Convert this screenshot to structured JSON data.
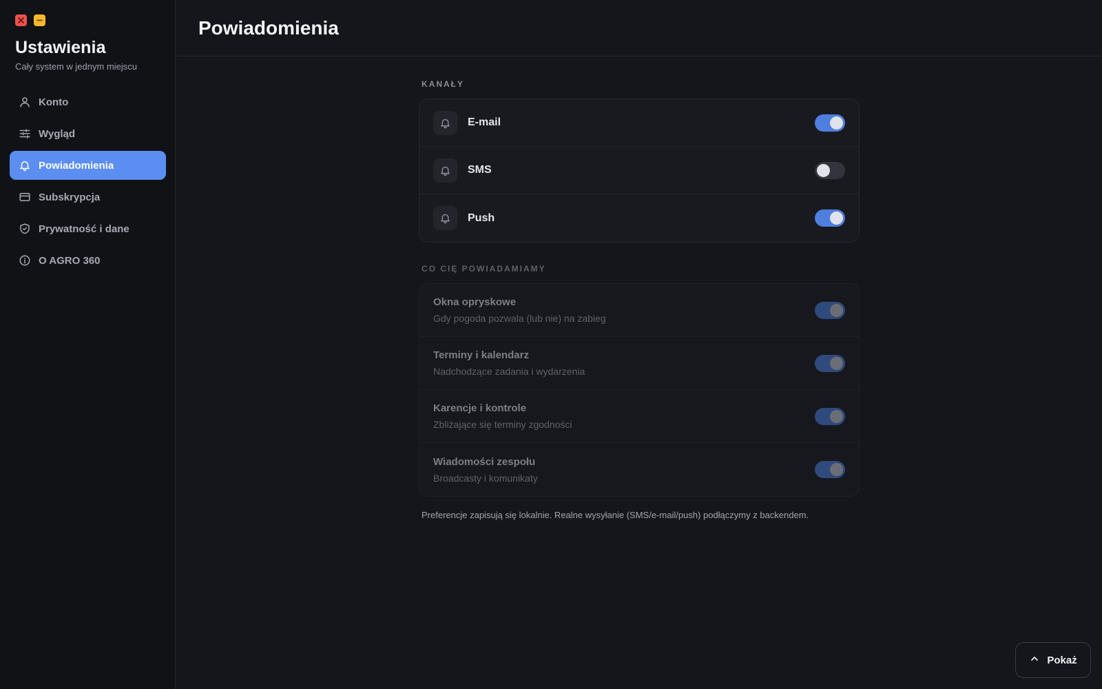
{
  "window": {
    "close_icon": "close-icon",
    "minimize_icon": "minimize-icon",
    "close_color": "#f0524b",
    "minimize_color": "#f5b82e"
  },
  "sidebar": {
    "title": "Ustawienia",
    "subtitle": "Cały system w jednym miejscu",
    "items": [
      {
        "label": "Konto",
        "icon": "user-icon",
        "active": false
      },
      {
        "label": "Wygląd",
        "icon": "sliders-icon",
        "active": false
      },
      {
        "label": "Powiadomienia",
        "icon": "bell-icon",
        "active": true
      },
      {
        "label": "Subskrypcja",
        "icon": "credit-card-icon",
        "active": false
      },
      {
        "label": "Prywatność i dane",
        "icon": "shield-check-icon",
        "active": false
      },
      {
        "label": "O AGRO 360",
        "icon": "info-icon",
        "active": false
      }
    ],
    "active_color": "#5b8ef0"
  },
  "header": {
    "title": "Powiadomienia"
  },
  "channels": {
    "label": "KANAŁY",
    "items": [
      {
        "label": "E-mail",
        "icon": "bell-icon",
        "enabled": true
      },
      {
        "label": "SMS",
        "icon": "bell-icon",
        "enabled": false
      },
      {
        "label": "Push",
        "icon": "bell-icon",
        "enabled": true
      }
    ]
  },
  "topics": {
    "label": "CO CIĘ POWIADAMIAMY",
    "items": [
      {
        "title": "Okna opryskowe",
        "desc": "Gdy pogoda pozwala (lub nie) na zabieg",
        "enabled": true
      },
      {
        "title": "Terminy i kalendarz",
        "desc": "Nadchodzące zadania i wydarzenia",
        "enabled": true
      },
      {
        "title": "Karencje i kontrole",
        "desc": "Zbliżające się terminy zgodności",
        "enabled": true
      },
      {
        "title": "Wiadomości zespołu",
        "desc": "Broadcasty i komunikaty",
        "enabled": true
      }
    ]
  },
  "footnote": "Preferencje zapisują się lokalnie. Realne wysyłanie (SMS/e-mail/push) podłączymy z backendem.",
  "show_button": {
    "label": "Pokaż",
    "icon": "chevron-up-icon"
  }
}
